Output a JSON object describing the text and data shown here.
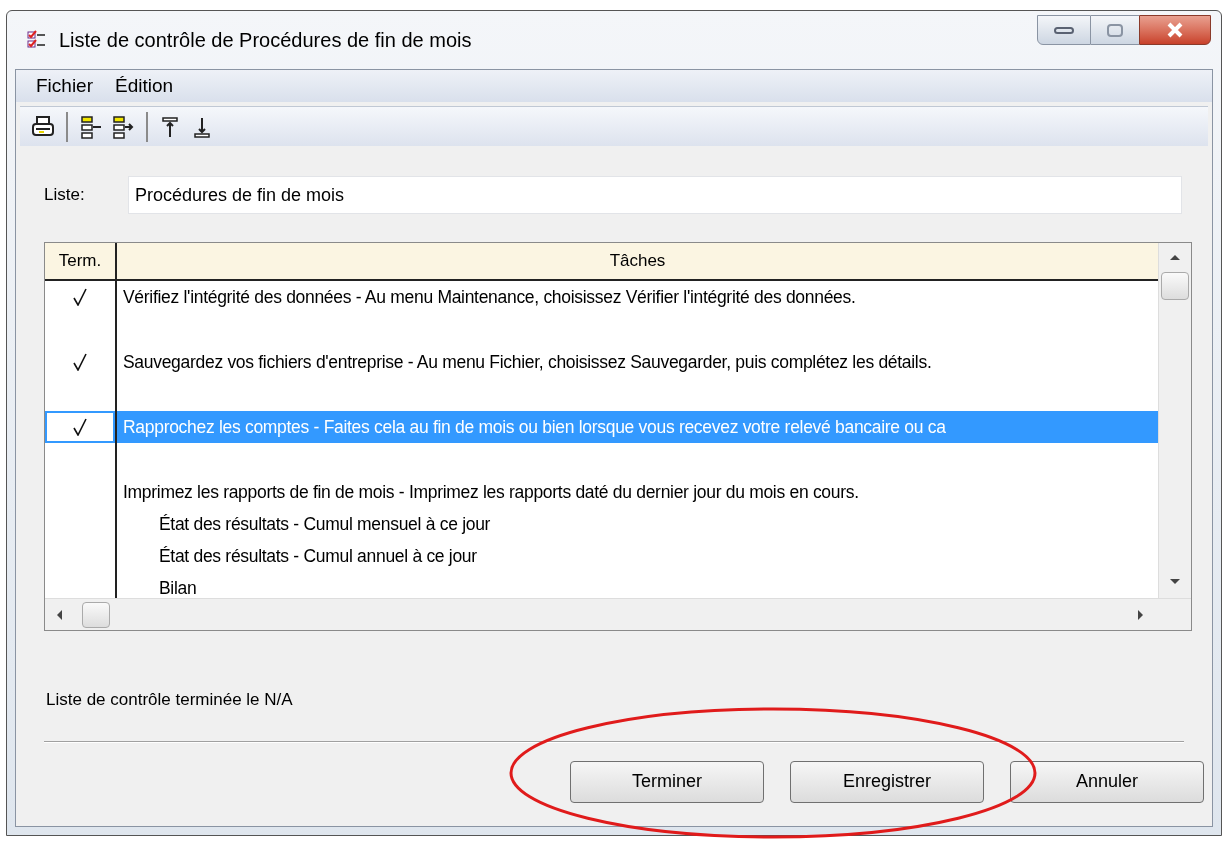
{
  "window": {
    "title": "Liste de contrôle de Procédures de fin de mois"
  },
  "menu": [
    "Fichier",
    "Édition"
  ],
  "toolbar": [
    {
      "kind": "print"
    },
    {
      "kind": "separator"
    },
    {
      "kind": "outdent"
    },
    {
      "kind": "indent"
    },
    {
      "kind": "separator"
    },
    {
      "kind": "move-top"
    },
    {
      "kind": "move-bottom"
    }
  ],
  "list_field": {
    "label": "Liste:",
    "value": "Procédures de fin de mois"
  },
  "table": {
    "columns": [
      "Term.",
      "Tâches"
    ],
    "rows": [
      {
        "done": true,
        "selected": false,
        "text": "Vérifiez l'intégrité des données - Au menu Maintenance, choisissez Vérifier l'intégrité des données."
      },
      {
        "done": true,
        "selected": false,
        "text": "Sauvegardez vos fichiers d'entreprise - Au menu Fichier, choisissez Sauvegarder, puis complétez les détails."
      },
      {
        "done": true,
        "selected": true,
        "text": "Rapprochez les comptes - Faites cela au fin de mois ou bien lorsque vous recevez votre relevé bancaire ou ca"
      },
      {
        "done": false,
        "selected": false,
        "text": "Imprimez les rapports de fin de mois - Imprimez les rapports daté du dernier jour du mois en cours.",
        "children": [
          {
            "text": "État des résultats - Cumul mensuel à ce jour"
          },
          {
            "text": "État des résultats - Cumul annuel à ce jour"
          },
          {
            "text": "Bilan"
          }
        ]
      }
    ]
  },
  "status_text": "Liste de contrôle terminée le N/A",
  "buttons": [
    "Terminer",
    "Enregistrer",
    "Annuler"
  ]
}
